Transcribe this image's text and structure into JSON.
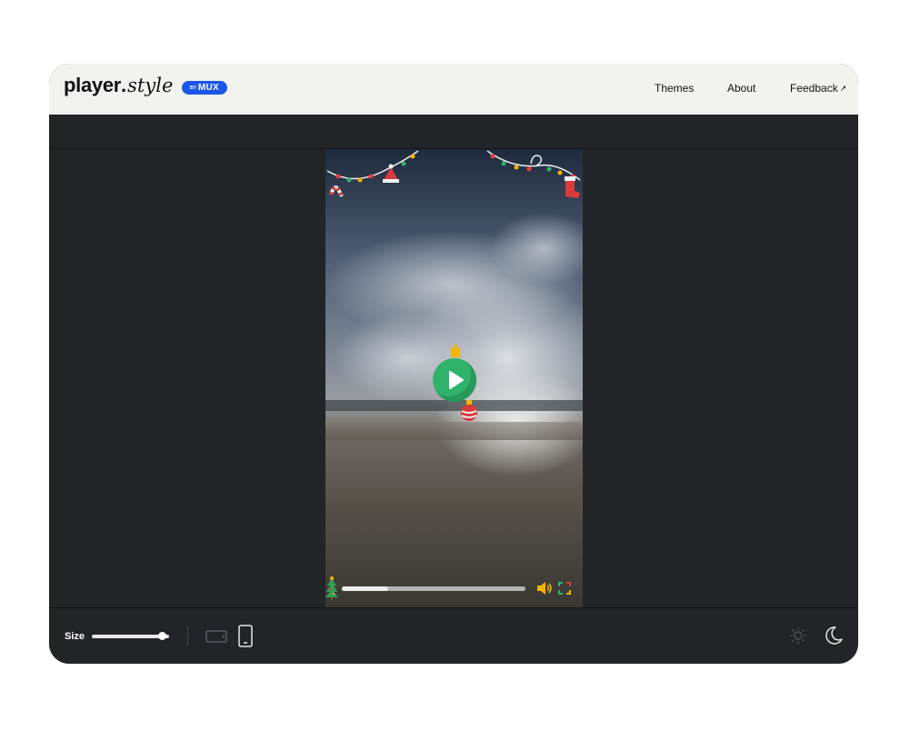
{
  "header": {
    "logo_main": "player",
    "logo_dot": ".",
    "logo_style": "style",
    "badge_by": "BY",
    "badge_name": "MUX",
    "nav": {
      "themes": "Themes",
      "about": "About",
      "feedback": "Feedback",
      "feedback_arrow": "↗"
    }
  },
  "player": {
    "progress": 0.25,
    "colors": {
      "play": "#2fb36b",
      "ornament_red": "#d93a3a",
      "ornament_gold": "#f4b400",
      "tree": "#2f9e57"
    }
  },
  "footer": {
    "size_label": "Size",
    "size_value": 0.9
  },
  "icons": [
    "landscape-icon",
    "portrait-icon",
    "sun-icon",
    "moon-icon",
    "play-icon",
    "volume-icon",
    "fullscreen-icon",
    "tree-icon"
  ]
}
